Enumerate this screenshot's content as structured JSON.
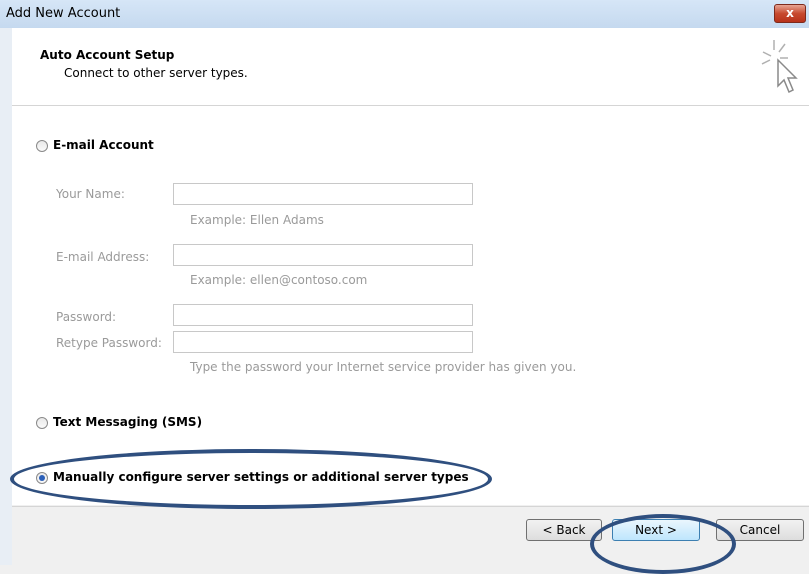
{
  "window": {
    "title": "Add New Account",
    "close_label": "x"
  },
  "header": {
    "title": "Auto Account Setup",
    "subtitle": "Connect to other server types.",
    "icon": "cursor-sparkle-icon"
  },
  "email_account": {
    "label": "E-mail Account",
    "selected": false,
    "fields": {
      "name": {
        "label": "Your Name:",
        "value": "",
        "hint": "Example: Ellen Adams"
      },
      "email": {
        "label": "E-mail Address:",
        "value": "",
        "hint": "Example: ellen@contoso.com"
      },
      "password": {
        "label": "Password:",
        "value": ""
      },
      "retype": {
        "label": "Retype Password:",
        "value": "",
        "hint": "Type the password your Internet service provider has given you."
      }
    }
  },
  "sms": {
    "label": "Text Messaging (SMS)",
    "selected": false
  },
  "manual": {
    "label": "Manually configure server settings or additional server types",
    "selected": true
  },
  "footer": {
    "back_label": "< Back",
    "next_label": "Next >",
    "cancel_label": "Cancel"
  },
  "colors": {
    "annotation": "#2f4f7f",
    "selected_radio": "#2b5fb8",
    "disabled_text": "#9a9a9a"
  }
}
